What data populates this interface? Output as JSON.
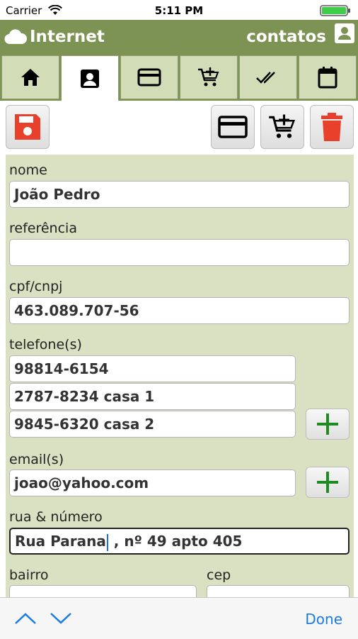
{
  "status_bar": {
    "carrier": "Carrier",
    "time": "5:11 PM"
  },
  "header": {
    "title": "Internet",
    "right_label": "contatos",
    "left_icon": "cloud-icon",
    "right_icon": "contact-card-icon"
  },
  "tabs": [
    {
      "icon": "home-icon"
    },
    {
      "icon": "contact-icon"
    },
    {
      "icon": "credit-card-icon"
    },
    {
      "icon": "cart-add-icon"
    },
    {
      "icon": "double-check-icon"
    },
    {
      "icon": "calendar-icon"
    }
  ],
  "toolbar": {
    "save_icon": "floppy-disk-icon",
    "card_icon": "credit-card-icon",
    "cart_icon": "cart-add-icon",
    "delete_icon": "trash-icon"
  },
  "form": {
    "nome": {
      "label": "nome",
      "value": "João Pedro"
    },
    "referencia": {
      "label": "referência",
      "value": ""
    },
    "cpf": {
      "label": "cpf/cnpj",
      "value": "463.089.707-56"
    },
    "telefones": {
      "label": "telefone(s)",
      "values": [
        "98814-6154",
        "2787-8234 casa 1",
        "9845-6320 casa 2"
      ]
    },
    "emails": {
      "label": "email(s)",
      "values": [
        "joao@yahoo.com"
      ]
    },
    "rua": {
      "label": "rua & número",
      "value_before_cursor": "Rua Parana",
      "value_after_cursor": " , nº 49 apto 405"
    },
    "bairro": {
      "label": "bairro"
    },
    "cep": {
      "label": "cep"
    }
  },
  "colors": {
    "header": "#7c9354",
    "form_bg": "#d9e1c2",
    "tab_bg": "#d2dcb7",
    "accent_red": "#e8402a",
    "plus_green": "#1f8a1f",
    "done_blue": "#1a7ae6"
  },
  "accessory": {
    "done": "Done"
  }
}
